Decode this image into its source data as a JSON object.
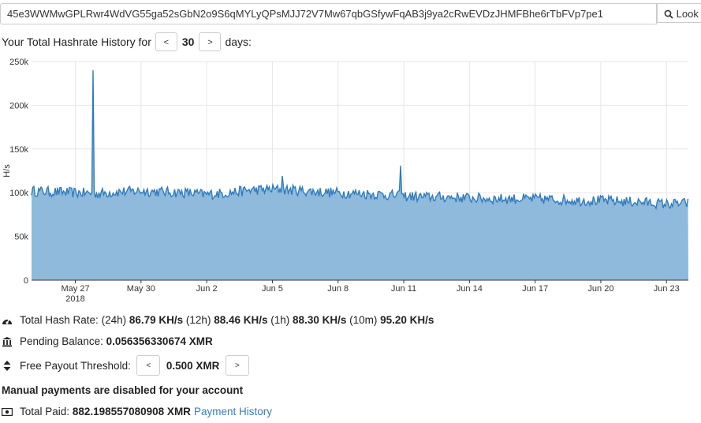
{
  "address": {
    "value": "45e3WWMwGPLRwr4WdVG55ga52sGbN2o9S6qMYLyQPsMJJ72V7Mw67qbGSfywFqAB3j9ya2cRwEVDzJHMFBhe6rTbFVp7pe1",
    "look_label": "Look"
  },
  "history": {
    "prefix": "Your Total Hashrate History for",
    "prev_label": "<",
    "days": "30",
    "next_label": ">",
    "suffix": "days:"
  },
  "chart_data": {
    "type": "area",
    "ylabel": "H/s",
    "ylim": [
      0,
      250000
    ],
    "yticks": [
      "0",
      "50k",
      "100k",
      "150k",
      "200k",
      "250k"
    ],
    "xticks": [
      "May 27",
      "May 30",
      "Jun 2",
      "Jun 5",
      "Jun 8",
      "Jun 11",
      "Jun 14",
      "Jun 17",
      "Jun 20",
      "Jun 23"
    ],
    "xticks_sub": [
      "2018",
      "",
      "",
      "",
      "",
      "",
      "",
      "",
      "",
      ""
    ],
    "xlim_days": [
      "2018-05-25",
      "2018-06-24"
    ],
    "series": [
      {
        "x": [
          "2018-05-25",
          "2018-05-26",
          "2018-05-27",
          "2018-05-28",
          "2018-05-29",
          "2018-05-30",
          "2018-05-31",
          "2018-06-01",
          "2018-06-02",
          "2018-06-03",
          "2018-06-04",
          "2018-06-05",
          "2018-06-06",
          "2018-06-07",
          "2018-06-08",
          "2018-06-09",
          "2018-06-10",
          "2018-06-11",
          "2018-06-12",
          "2018-06-13",
          "2018-06-14",
          "2018-06-15",
          "2018-06-16",
          "2018-06-17",
          "2018-06-18",
          "2018-06-19",
          "2018-06-20",
          "2018-06-21",
          "2018-06-22",
          "2018-06-23",
          "2018-06-24"
        ],
        "values": [
          102000,
          101000,
          100000,
          99000,
          101000,
          102000,
          101000,
          100000,
          98000,
          100000,
          103000,
          104000,
          103000,
          101000,
          100000,
          99000,
          98000,
          96000,
          95000,
          95000,
          94000,
          93000,
          93000,
          93000,
          92000,
          91000,
          91000,
          90000,
          89000,
          87000,
          88000
        ],
        "spikes": [
          {
            "x": "2018-05-27",
            "value": 240000
          },
          {
            "x": "2018-06-10",
            "value": 131000
          },
          {
            "x": "2018-06-05",
            "value": 119000
          }
        ]
      }
    ],
    "colors": {
      "fill": "#8fbadc",
      "line": "#2f7bbd",
      "grid": "#e6e6e6",
      "axis": "#333"
    }
  },
  "stats": {
    "hash_label": "Total Hash Rate:",
    "p24_label": "(24h)",
    "p24_val": "86.79 KH/s",
    "p12_label": "(12h)",
    "p12_val": "88.46 KH/s",
    "p1_label": "(1h)",
    "p1_val": "88.30 KH/s",
    "p10_label": "(10m)",
    "p10_val": "95.20 KH/s",
    "pending_label": "Pending Balance:",
    "pending_val": "0.056356330674 XMR",
    "threshold_label": "Free Payout Threshold:",
    "threshold_prev": "<",
    "threshold_val": "0.500 XMR",
    "threshold_next": ">",
    "manual_notice": "Manual payments are disabled for your account",
    "paid_label": "Total Paid:",
    "paid_val": "882.198557080908 XMR",
    "history_link": "Payment History"
  }
}
